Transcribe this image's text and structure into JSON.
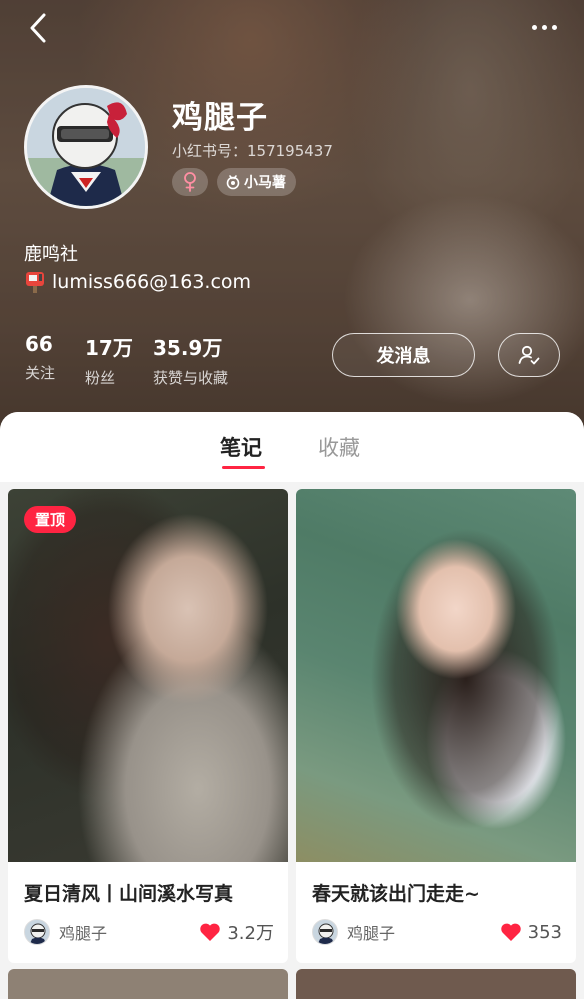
{
  "profile": {
    "name": "鸡腿子",
    "id_text": "小红书号：157195437",
    "level_label": "小马薯",
    "bio_line1": "鹿鸣社",
    "bio_line2": "lumiss666@163.com",
    "stats": [
      {
        "value": "66",
        "label": "关注"
      },
      {
        "value": "17万",
        "label": "粉丝"
      },
      {
        "value": "35.9万",
        "label": "获赞与收藏"
      }
    ],
    "message_label": "发消息"
  },
  "tabs": {
    "notes": "笔记",
    "collections": "收藏"
  },
  "notes": [
    {
      "pinned_label": "置顶",
      "title": "夏日清风丨山间溪水写真",
      "author": "鸡腿子",
      "likes": "3.2万"
    },
    {
      "title": "春天就该出门走走~",
      "author": "鸡腿子",
      "likes": "353"
    }
  ],
  "colors": {
    "accent": "#ff2442",
    "tab_active": "#222222",
    "tab_inactive": "#999999"
  },
  "icons": {
    "back": "chevron-left-icon",
    "more": "more-dots-icon",
    "gender": "female-icon",
    "level": "level-badge-icon",
    "mailbox": "mailbox-icon",
    "follow": "user-check-icon",
    "like": "heart-icon"
  }
}
